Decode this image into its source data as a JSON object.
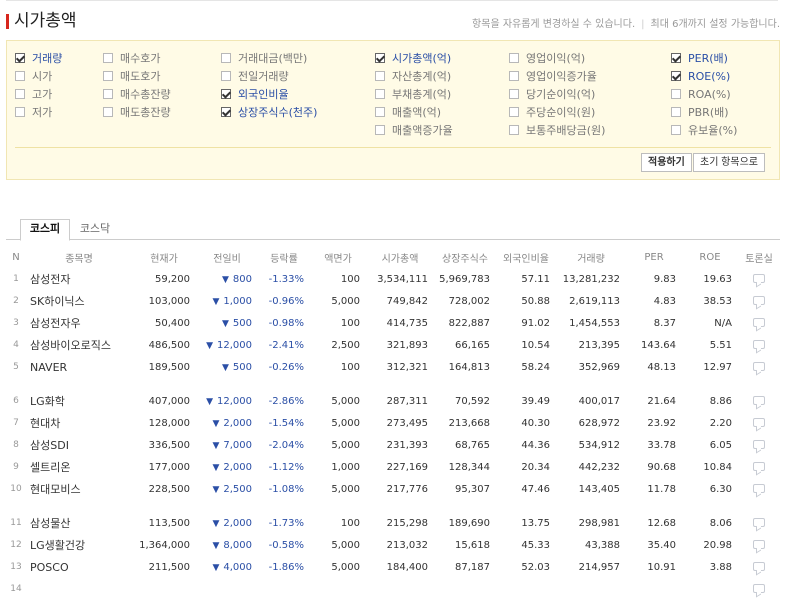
{
  "header": {
    "title": "시가총액",
    "notice_1": "항목을 자유롭게 변경하실 수 있습니다.",
    "notice_sep": "|",
    "notice_2": "최대 6개까지 설정 가능합니다."
  },
  "options": {
    "columns": [
      [
        {
          "label": "거래량",
          "checked": true
        },
        {
          "label": "시가",
          "checked": false
        },
        {
          "label": "고가",
          "checked": false
        },
        {
          "label": "저가",
          "checked": false
        }
      ],
      [
        {
          "label": "매수호가",
          "checked": false
        },
        {
          "label": "매도호가",
          "checked": false
        },
        {
          "label": "매수총잔량",
          "checked": false
        },
        {
          "label": "매도총잔량",
          "checked": false
        }
      ],
      [
        {
          "label": "거래대금(백만)",
          "checked": false
        },
        {
          "label": "전일거래량",
          "checked": false
        },
        {
          "label": "외국인비율",
          "checked": true
        },
        {
          "label": "상장주식수(천주)",
          "checked": true
        }
      ],
      [
        {
          "label": "시가총액(억)",
          "checked": true
        },
        {
          "label": "자산총계(억)",
          "checked": false
        },
        {
          "label": "부채총계(억)",
          "checked": false
        },
        {
          "label": "매출액(억)",
          "checked": false
        },
        {
          "label": "매출액증가율",
          "checked": false
        }
      ],
      [
        {
          "label": "영업이익(억)",
          "checked": false
        },
        {
          "label": "영업이익증가율",
          "checked": false
        },
        {
          "label": "당기순이익(억)",
          "checked": false
        },
        {
          "label": "주당순이익(원)",
          "checked": false
        },
        {
          "label": "보통주배당금(원)",
          "checked": false
        }
      ],
      [
        {
          "label": "PER(배)",
          "checked": true
        },
        {
          "label": "ROE(%)",
          "checked": true
        },
        {
          "label": "ROA(%)",
          "checked": false
        },
        {
          "label": "PBR(배)",
          "checked": false
        },
        {
          "label": "유보율(%)",
          "checked": false
        }
      ]
    ],
    "apply_label": "적용하기",
    "reset_label": "초기 항목으로"
  },
  "tabs": [
    {
      "label": "코스피",
      "active": true
    },
    {
      "label": "코스닥",
      "active": false
    }
  ],
  "table": {
    "headers": [
      "N",
      "종목명",
      "현재가",
      "전일비",
      "등락률",
      "액면가",
      "시가총액",
      "상장주식수",
      "외국인비율",
      "거래량",
      "PER",
      "ROE",
      "토론실"
    ],
    "groups": [
      [
        {
          "n": "1",
          "name": "삼성전자",
          "price": "59,200",
          "change": "800",
          "rate": "-1.33%",
          "par": "100",
          "cap": "3,534,111",
          "shares": "5,969,783",
          "foreign": "57.11",
          "volume": "13,281,232",
          "per": "9.83",
          "roe": "19.63"
        },
        {
          "n": "2",
          "name": "SK하이닉스",
          "price": "103,000",
          "change": "1,000",
          "rate": "-0.96%",
          "par": "5,000",
          "cap": "749,842",
          "shares": "728,002",
          "foreign": "50.88",
          "volume": "2,619,113",
          "per": "4.83",
          "roe": "38.53"
        },
        {
          "n": "3",
          "name": "삼성전자우",
          "price": "50,400",
          "change": "500",
          "rate": "-0.98%",
          "par": "100",
          "cap": "414,735",
          "shares": "822,887",
          "foreign": "91.02",
          "volume": "1,454,553",
          "per": "8.37",
          "roe": "N/A"
        },
        {
          "n": "4",
          "name": "삼성바이오로직스",
          "price": "486,500",
          "change": "12,000",
          "rate": "-2.41%",
          "par": "2,500",
          "cap": "321,893",
          "shares": "66,165",
          "foreign": "10.54",
          "volume": "213,395",
          "per": "143.64",
          "roe": "5.51"
        },
        {
          "n": "5",
          "name": "NAVER",
          "price": "189,500",
          "change": "500",
          "rate": "-0.26%",
          "par": "100",
          "cap": "312,321",
          "shares": "164,813",
          "foreign": "58.24",
          "volume": "352,969",
          "per": "48.13",
          "roe": "12.97"
        }
      ],
      [
        {
          "n": "6",
          "name": "LG화학",
          "price": "407,000",
          "change": "12,000",
          "rate": "-2.86%",
          "par": "5,000",
          "cap": "287,311",
          "shares": "70,592",
          "foreign": "39.49",
          "volume": "400,017",
          "per": "21.64",
          "roe": "8.86"
        },
        {
          "n": "7",
          "name": "현대차",
          "price": "128,000",
          "change": "2,000",
          "rate": "-1.54%",
          "par": "5,000",
          "cap": "273,495",
          "shares": "213,668",
          "foreign": "40.30",
          "volume": "628,972",
          "per": "23.92",
          "roe": "2.20"
        },
        {
          "n": "8",
          "name": "삼성SDI",
          "price": "336,500",
          "change": "7,000",
          "rate": "-2.04%",
          "par": "5,000",
          "cap": "231,393",
          "shares": "68,765",
          "foreign": "44.36",
          "volume": "534,912",
          "per": "33.78",
          "roe": "6.05"
        },
        {
          "n": "9",
          "name": "셀트리온",
          "price": "177,000",
          "change": "2,000",
          "rate": "-1.12%",
          "par": "1,000",
          "cap": "227,169",
          "shares": "128,344",
          "foreign": "20.34",
          "volume": "442,232",
          "per": "90.68",
          "roe": "10.84"
        },
        {
          "n": "10",
          "name": "현대모비스",
          "price": "228,500",
          "change": "2,500",
          "rate": "-1.08%",
          "par": "5,000",
          "cap": "217,776",
          "shares": "95,307",
          "foreign": "47.46",
          "volume": "143,405",
          "per": "11.78",
          "roe": "6.30"
        }
      ],
      [
        {
          "n": "11",
          "name": "삼성물산",
          "price": "113,500",
          "change": "2,000",
          "rate": "-1.73%",
          "par": "100",
          "cap": "215,298",
          "shares": "189,690",
          "foreign": "13.75",
          "volume": "298,981",
          "per": "12.68",
          "roe": "8.06"
        },
        {
          "n": "12",
          "name": "LG생활건강",
          "price": "1,364,000",
          "change": "8,000",
          "rate": "-0.58%",
          "par": "5,000",
          "cap": "213,032",
          "shares": "15,618",
          "foreign": "45.33",
          "volume": "43,388",
          "per": "35.40",
          "roe": "20.98"
        },
        {
          "n": "13",
          "name": "POSCO",
          "price": "211,500",
          "change": "4,000",
          "rate": "-1.86%",
          "par": "5,000",
          "cap": "184,400",
          "shares": "87,187",
          "foreign": "52.03",
          "volume": "214,957",
          "per": "10.91",
          "roe": "3.88"
        },
        {
          "n": "14",
          "name": "",
          "price": "",
          "change": "",
          "rate": "",
          "par": "",
          "cap": "",
          "shares": "",
          "foreign": "",
          "volume": "",
          "per": "",
          "roe": ""
        }
      ]
    ]
  },
  "icons": {
    "down_arrow": "▼",
    "discussion": "speech-bubble-icon"
  },
  "colors": {
    "accent_red": "#d7261d",
    "down_blue": "#2b4fa6",
    "option_bg": "#fffbe6"
  }
}
